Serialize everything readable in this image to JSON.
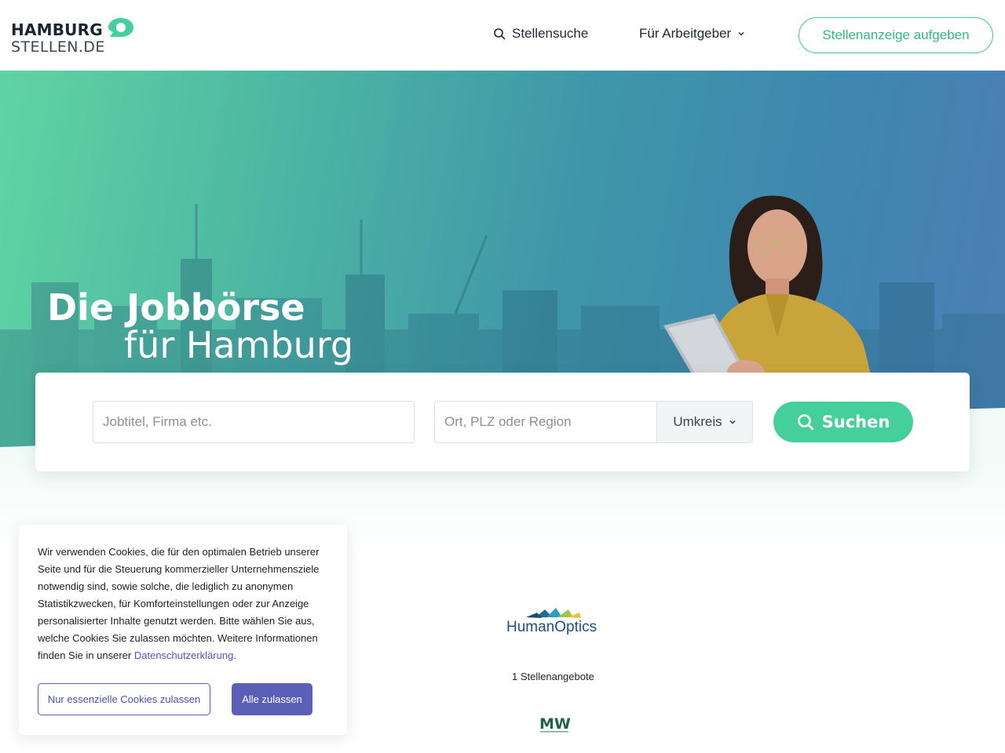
{
  "header": {
    "logo": {
      "line1": "HAMBURG",
      "line2": "STELLEN.DE"
    },
    "nav": {
      "search_label": "Stellensuche",
      "employer_label": "Für Arbeitgeber"
    },
    "cta_label": "Stellenanzeige aufgeben"
  },
  "hero": {
    "title_line1": "Die Jobbörse",
    "title_line2": "für Hamburg"
  },
  "search": {
    "job_placeholder": "Jobtitel, Firma etc.",
    "location_placeholder": "Ort, PLZ oder Region",
    "radius_label": "Umkreis",
    "submit_label": "Suchen"
  },
  "companies": {
    "featured_name": "HumanOptics",
    "featured_count": "1 Stellenangebote",
    "second_logo_text": "MW"
  },
  "cookie": {
    "text": "Wir verwenden Cookies, die für den optimalen Betrieb unserer Seite und für die Steuerung kommerzieller Unternehmensziele notwendig sind, sowie solche, die lediglich zu anonymen Statistikzwecken, für Komforteinstellungen oder zur Anzeige personalisierter Inhalte genutzt werden. Bitte wählen Sie aus, welche Cookies Sie zulassen möchten. Weitere Informationen finden Sie in unserer ",
    "link_text": "Datenschutzerklärung",
    "text_end": ".",
    "essential_label": "Nur essenzielle Cookies zulassen",
    "accept_all_label": "Alle zulassen"
  },
  "colors": {
    "accent": "#45cf9a",
    "cookie_button": "#5c5fb6"
  }
}
